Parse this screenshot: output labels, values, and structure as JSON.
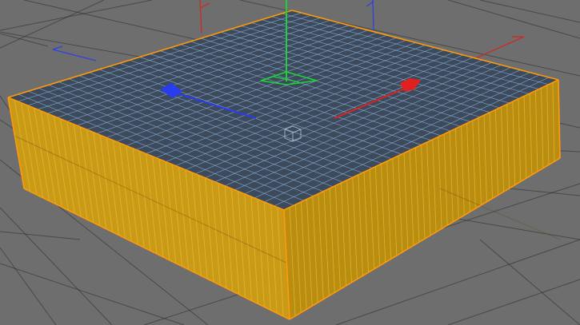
{
  "viewport": {
    "mode": "3d-perspective-viewport",
    "background_color": "#6e6e6e",
    "grid_line_color": "#2a2a2a"
  },
  "object": {
    "shape": "box",
    "selected": true,
    "selection_outline_color": "#ff9a0a",
    "top_face_color": "#3c4a5c",
    "top_wire_color": "#8fb6e0",
    "side_face_color": "#c89a18",
    "side_wire_color": "#e8b820",
    "top_segments": [
      28,
      28
    ],
    "side_segments": [
      42,
      48
    ]
  },
  "gizmo": {
    "type": "move-tool",
    "x_axis_color": "#e0211f",
    "y_axis_color": "#1fd03a",
    "z_axis_color": "#2a3cf0",
    "icons": [
      "x-axis-arrow-icon",
      "y-axis-handle-icon",
      "z-axis-arrow-icon",
      "pivot-cube-icon"
    ]
  }
}
